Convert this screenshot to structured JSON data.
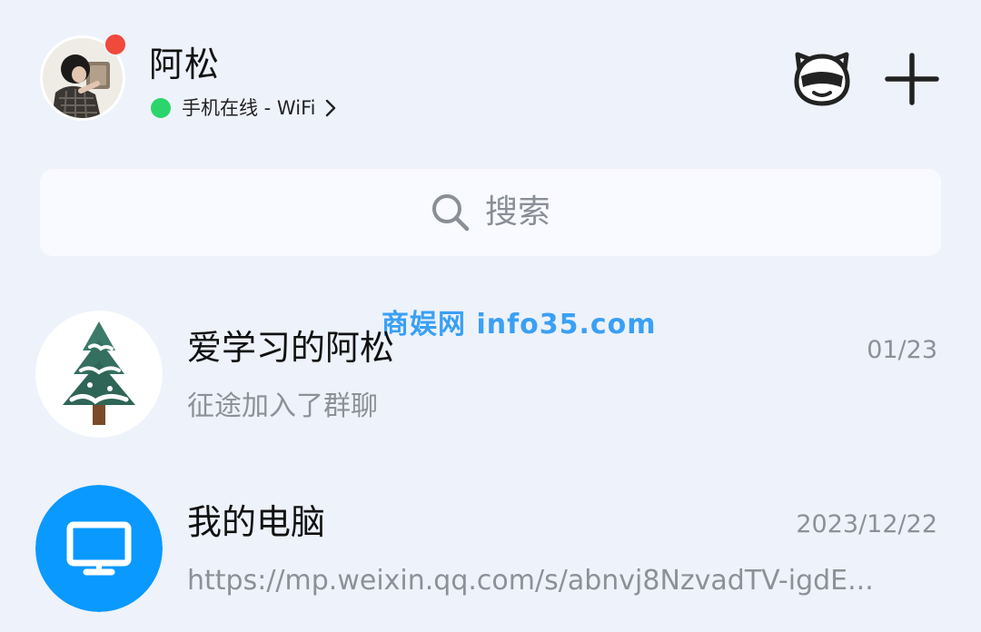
{
  "header": {
    "user_name": "阿松",
    "status_text": "手机在线 - WiFi"
  },
  "search": {
    "placeholder": "搜索"
  },
  "watermark": "商娱网 info35.com",
  "chats": [
    {
      "title": "爱学习的阿松",
      "time": "01/23",
      "preview": "征途加入了群聊"
    },
    {
      "title": "我的电脑",
      "time": "2023/12/22",
      "preview": "https://mp.weixin.qq.com/s/abnvj8NzvadTV-igdE..."
    }
  ],
  "icons": {
    "avatar": "user-avatar-photo",
    "notify": "notification-dot",
    "status": "online-status-dot",
    "face": "animal-face-icon",
    "plus": "plus-icon",
    "search": "search-icon",
    "group_avatar": "christmas-tree-icon",
    "computer_avatar": "monitor-icon"
  },
  "colors": {
    "background": "#eef2fb",
    "online_green": "#2bd56b",
    "notification_red": "#f04a3c",
    "computer_blue": "#0a99ff",
    "watermark_blue": "#3aa0f5"
  }
}
